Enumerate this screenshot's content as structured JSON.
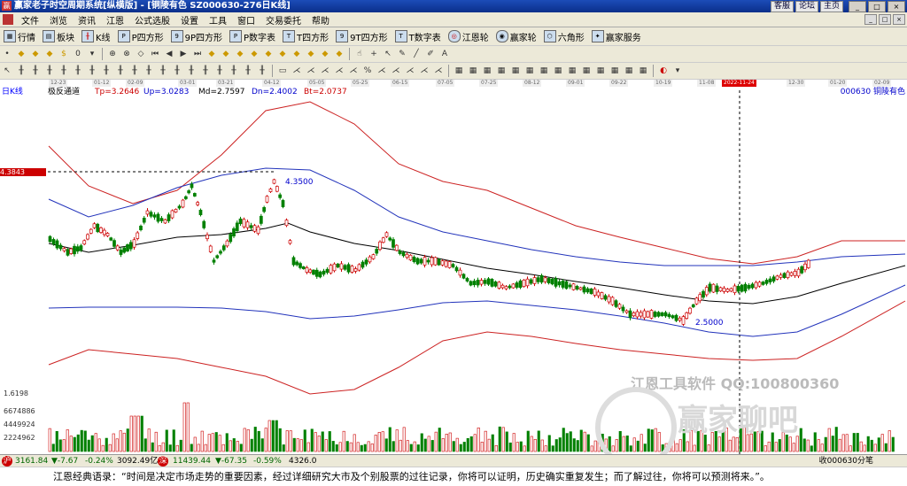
{
  "window": {
    "title": "赢家老子时空周期系统[纵横版] - [铜陵有色  SZ000630-276日K线]",
    "links": [
      "客服",
      "论坛",
      "主页"
    ],
    "buttons": [
      "_",
      "□",
      "×"
    ]
  },
  "menu": {
    "items": [
      "文件",
      "浏览",
      "资讯",
      "江恩",
      "公式选股",
      "设置",
      "工具",
      "窗口",
      "交易委托",
      "帮助"
    ]
  },
  "toolbar1": {
    "items": [
      {
        "icon": "quote-icon",
        "label": "行情"
      },
      {
        "icon": "block-icon",
        "label": "板块"
      },
      {
        "icon": "kline-icon",
        "label": "K线"
      },
      {
        "icon": "p-icon",
        "label": "P四方形"
      },
      {
        "icon": "9p-icon",
        "label": "9P四方形"
      },
      {
        "icon": "p-icon",
        "label": "P数字表"
      },
      {
        "icon": "t-icon",
        "label": "T四方形"
      },
      {
        "icon": "9t-icon",
        "label": "9T四方形"
      },
      {
        "icon": "tn-icon",
        "label": "T数字表"
      },
      {
        "icon": "gann-wheel-icon",
        "label": "江恩轮"
      },
      {
        "icon": "winner-wheel-icon",
        "label": "赢家轮"
      },
      {
        "icon": "hexagon-icon",
        "label": "六角形"
      },
      {
        "icon": "service-icon",
        "label": "赢家服务"
      }
    ]
  },
  "chart_header": {
    "period": "日K线",
    "indicator": "极反通道",
    "tp": "Tp=3.2646",
    "up": "Up=3.0283",
    "md": "Md=2.7597",
    "dn": "Dn=2.4002",
    "bt": "Bt=2.0737",
    "stock": "000630  铜陵有色"
  },
  "date_axis": {
    "ticks": [
      "12-23",
      "01-12",
      "02-09",
      "03-01",
      "03-21",
      "04-12",
      "05-05",
      "05-25",
      "06-15",
      "07-05",
      "07-25",
      "08-12",
      "09-01",
      "09-22",
      "10-19",
      "11-08",
      "2022-11-24",
      "12-30",
      "01-20",
      "02-09"
    ],
    "highlight": "2022-11-24"
  },
  "price_labels": {
    "cursor_price": "4.3843",
    "high_label": "4.3500",
    "low_label": "2.5000",
    "band_low": "1.6198"
  },
  "volume_labels": [
    "6674886",
    "4449924",
    "2224962"
  ],
  "watermark": {
    "line1": "江恩工具软件  QQ:100800360",
    "line2": "赢家聊吧"
  },
  "status": {
    "sh_index": "3161.84",
    "sh_change": "▼-7.67",
    "sh_pct": "-0.24%",
    "sh_amount": "3092.49亿",
    "sz_index": "11439.44",
    "sz_change": "▼-67.35",
    "sz_pct": "-0.59%",
    "sz_amount": "4326.0",
    "right": "收000630分笔"
  },
  "quote": "江恩经典语录：“时间是决定市场走势的重要因素，经过详细研究大市及个别股票的过往记录，你将可以证明，历史确实重复发生；而了解过往，你将可以预测将来。”。",
  "colors": {
    "band_outer": "#cc2222",
    "band_inner": "#2233bb",
    "mid_line": "#000000",
    "candle_up": "#cc0000",
    "candle_down": "#008000",
    "volume": "#cc0000"
  },
  "chart_data": {
    "type": "candlestick",
    "indicator_values": {
      "Tp": 3.2646,
      "Up": 3.0283,
      "Md": 2.7597,
      "Dn": 2.4002,
      "Bt": 2.0737
    },
    "annotations": [
      {
        "label": "4.3500"
      },
      {
        "label": "2.5000"
      }
    ]
  }
}
